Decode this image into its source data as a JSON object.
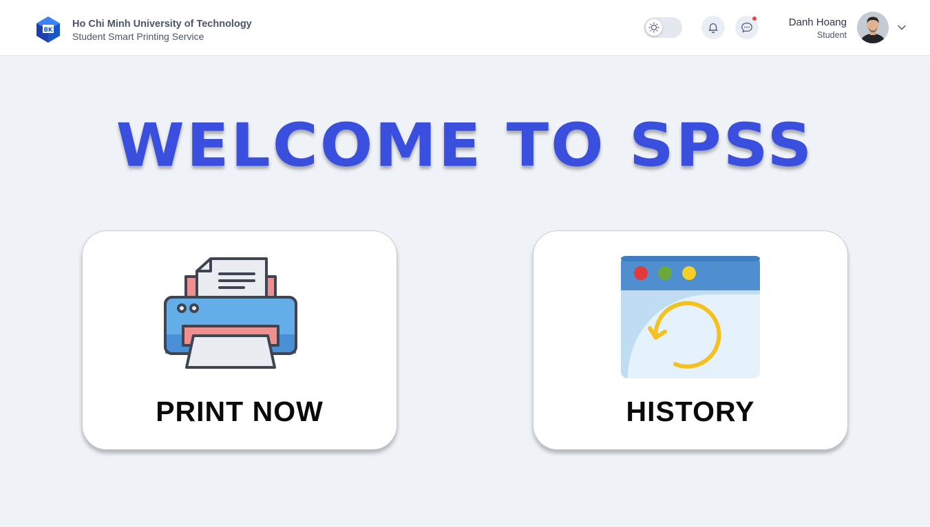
{
  "header": {
    "university": "Ho Chi Minh University of Technology",
    "service": "Student Smart Printing Service",
    "logo_icon": "bk-logo-icon",
    "theme_toggle_icon": "sun-icon",
    "notifications_icon": "bell-icon",
    "messages_icon": "chat-bubble-icon",
    "user": {
      "name": "Danh Hoang",
      "role": "Student"
    },
    "menu_icon": "chevron-down-icon"
  },
  "main": {
    "welcome_title": "WELCOME TO SPSS",
    "cards": [
      {
        "label": "PRINT NOW",
        "icon": "printer-icon"
      },
      {
        "label": "HISTORY",
        "icon": "history-icon"
      }
    ]
  },
  "colors": {
    "accent": "#3b4fdf",
    "background": "#eff3f8",
    "notification_dot": "#ef4444"
  }
}
